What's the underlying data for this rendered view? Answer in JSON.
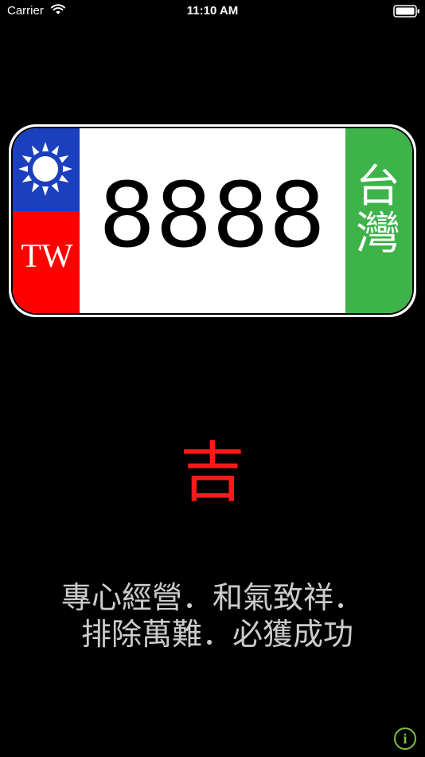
{
  "status_bar": {
    "carrier": "Carrier",
    "time": "11:10 AM"
  },
  "plate": {
    "number": "8888",
    "country_code": "TW",
    "region": "台灣",
    "flag_icon": "sun-emblem-flag-icon",
    "colors": {
      "flag_blue": "#1a3fbf",
      "flag_red": "#ff0000",
      "region_green": "#3db34a",
      "plate_white": "#ffffff"
    }
  },
  "result": {
    "verdict": "吉",
    "verdict_color": "#ff1a1a",
    "poem_lines": [
      "專心經營．和氣致祥．",
      " 排除萬難．必獲成功"
    ]
  },
  "info": {
    "label": "i",
    "icon": "info-icon"
  }
}
